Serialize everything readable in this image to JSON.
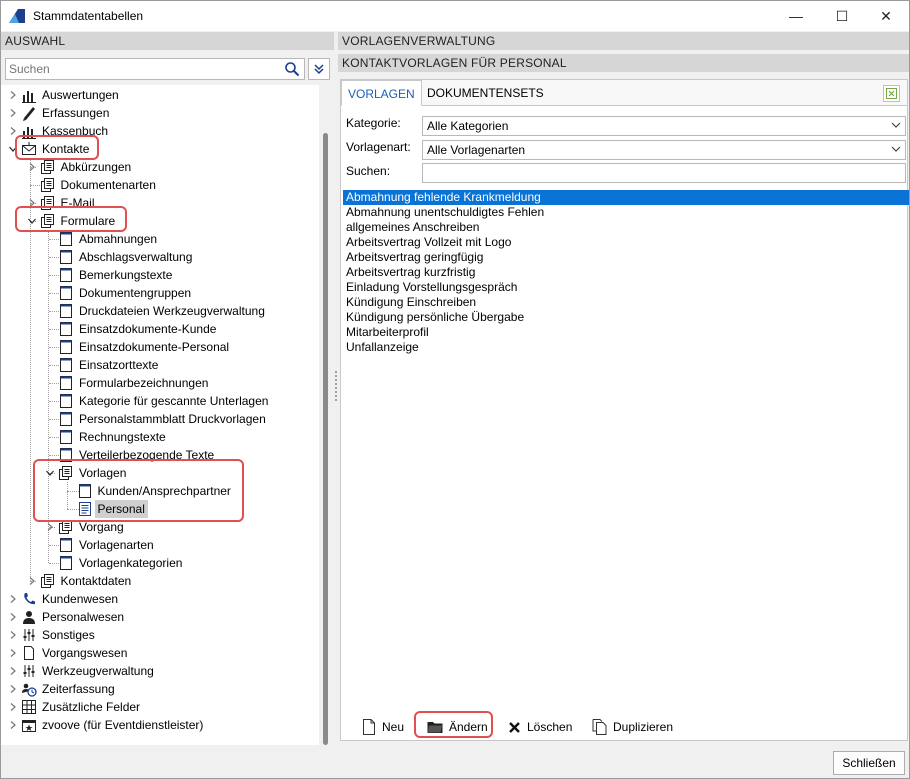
{
  "window": {
    "title": "Stammdatentabellen",
    "min_glyph": "—",
    "max_glyph": "☐",
    "close_glyph": "✕",
    "close_button": "Schließen"
  },
  "left": {
    "header": "AUSWAHL",
    "search_placeholder": "Suchen",
    "tree": [
      {
        "label": "Auswertungen",
        "level": 0,
        "toggle": "right",
        "icon": "bar-chart-icon"
      },
      {
        "label": "Erfassungen",
        "level": 0,
        "toggle": "right",
        "icon": "pencil-icon"
      },
      {
        "label": "Kassenbuch",
        "level": 0,
        "toggle": "right",
        "icon": "bar-chart-icon"
      },
      {
        "label": "Kontakte",
        "level": 0,
        "toggle": "down",
        "icon": "envelope-icon"
      },
      {
        "label": "Abkürzungen",
        "level": 1,
        "toggle": "right",
        "icon": "document-stack-icon"
      },
      {
        "label": "Dokumentenarten",
        "level": 1,
        "toggle": "none",
        "icon": "document-stack-icon"
      },
      {
        "label": "E-Mail",
        "level": 1,
        "toggle": "right",
        "icon": "document-stack-icon"
      },
      {
        "label": "Formulare",
        "level": 1,
        "toggle": "down",
        "icon": "document-stack-icon"
      },
      {
        "label": "Abmahnungen",
        "level": 2,
        "toggle": "none",
        "icon": "form-icon"
      },
      {
        "label": "Abschlagsverwaltung",
        "level": 2,
        "toggle": "none",
        "icon": "form-icon"
      },
      {
        "label": "Bemerkungstexte",
        "level": 2,
        "toggle": "none",
        "icon": "form-icon"
      },
      {
        "label": "Dokumentengruppen",
        "level": 2,
        "toggle": "none",
        "icon": "form-icon"
      },
      {
        "label": "Druckdateien Werkzeugverwaltung",
        "level": 2,
        "toggle": "none",
        "icon": "form-icon"
      },
      {
        "label": "Einsatzdokumente-Kunde",
        "level": 2,
        "toggle": "none",
        "icon": "form-icon"
      },
      {
        "label": "Einsatzdokumente-Personal",
        "level": 2,
        "toggle": "none",
        "icon": "form-icon"
      },
      {
        "label": "Einsatzorttexte",
        "level": 2,
        "toggle": "none",
        "icon": "form-icon"
      },
      {
        "label": "Formularbezeichnungen",
        "level": 2,
        "toggle": "none",
        "icon": "form-icon"
      },
      {
        "label": "Kategorie für gescannte Unterlagen",
        "level": 2,
        "toggle": "none",
        "icon": "form-icon"
      },
      {
        "label": "Personalstammblatt Druckvorlagen",
        "level": 2,
        "toggle": "none",
        "icon": "form-icon"
      },
      {
        "label": "Rechnungstexte",
        "level": 2,
        "toggle": "none",
        "icon": "form-icon"
      },
      {
        "label": "Verteilerbezogende Texte",
        "level": 2,
        "toggle": "none",
        "icon": "form-icon"
      },
      {
        "label": "Vorlagen",
        "level": 2,
        "toggle": "down",
        "icon": "document-stack-icon"
      },
      {
        "label": "Kunden/Ansprechpartner",
        "level": 3,
        "toggle": "none",
        "icon": "form-icon"
      },
      {
        "label": "Personal",
        "level": 3,
        "toggle": "none",
        "icon": "document-lines-icon",
        "selected": true
      },
      {
        "label": "Vorgang",
        "level": 2,
        "toggle": "right",
        "icon": "document-stack-icon"
      },
      {
        "label": "Vorlagenarten",
        "level": 2,
        "toggle": "none",
        "icon": "form-icon"
      },
      {
        "label": "Vorlagenkategorien",
        "level": 2,
        "toggle": "none",
        "icon": "form-icon"
      },
      {
        "label": "Kontaktdaten",
        "level": 1,
        "toggle": "right",
        "icon": "document-stack-icon"
      },
      {
        "label": "Kundenwesen",
        "level": 0,
        "toggle": "right",
        "icon": "phone-icon"
      },
      {
        "label": "Personalwesen",
        "level": 0,
        "toggle": "right",
        "icon": "person-icon"
      },
      {
        "label": "Sonstiges",
        "level": 0,
        "toggle": "right",
        "icon": "sliders-icon"
      },
      {
        "label": "Vorgangswesen",
        "level": 0,
        "toggle": "right",
        "icon": "blank-document-icon"
      },
      {
        "label": "Werkzeugverwaltung",
        "level": 0,
        "toggle": "right",
        "icon": "sliders-icon"
      },
      {
        "label": "Zeiterfassung",
        "level": 0,
        "toggle": "right",
        "icon": "people-clock-icon"
      },
      {
        "label": "Zusätzliche Felder",
        "level": 0,
        "toggle": "right",
        "icon": "grid-icon"
      },
      {
        "label": "zvoove (für Eventdienstleister)",
        "level": 0,
        "toggle": "right",
        "icon": "calendar-star-icon"
      }
    ]
  },
  "right": {
    "header1": "VORLAGENVERWALTUNG",
    "header2": "KONTAKTVORLAGEN FÜR PERSONAL",
    "tabs": [
      {
        "label": "VORLAGEN",
        "active": true
      },
      {
        "label": "DOKUMENTENSETS",
        "active": false
      }
    ],
    "kategorie_label": "Kategorie:",
    "kategorie_value": "Alle Kategorien",
    "vorlagenart_label": "Vorlagenart:",
    "vorlagenart_value": "Alle Vorlagenarten",
    "suchen_label": "Suchen:",
    "suchen_value": "",
    "list": [
      "Abmahnung fehlende Krankmeldung",
      "Abmahnung unentschuldigtes Fehlen",
      "allgemeines Anschreiben",
      "Arbeitsvertrag Vollzeit mit Logo",
      "Arbeitsvertrag geringfügig",
      "Arbeitsvertrag kurzfristig",
      "Einladung Vorstellungsgespräch",
      "Kündigung Einschreiben",
      "Kündigung persönliche Übergabe",
      "Mitarbeiterprofil",
      "Unfallanzeige"
    ],
    "selected_index": 0,
    "actions": {
      "new": "Neu",
      "edit": "Ändern",
      "delete": "Löschen",
      "duplicate": "Duplizieren"
    }
  },
  "colors": {
    "selection": "#0a74d6",
    "highlight": "#e05050",
    "tab_active_text": "#1a5fb4",
    "header_bg": "#d6d6d6"
  }
}
